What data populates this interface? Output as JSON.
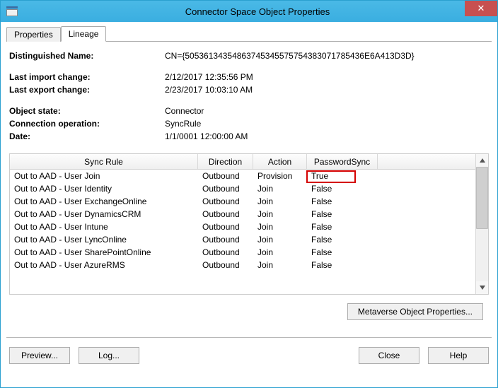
{
  "window": {
    "title": "Connector Space Object Properties"
  },
  "tabs": {
    "properties": "Properties",
    "lineage": "Lineage"
  },
  "info": {
    "dn_label": "Distinguished Name:",
    "dn_value": "CN={50536134354863745345575754383071785436E6A413D3D}",
    "last_import_label": "Last import change:",
    "last_import_value": "2/12/2017 12:35:56 PM",
    "last_export_label": "Last export change:",
    "last_export_value": "2/23/2017 10:03:10 AM",
    "object_state_label": "Object state:",
    "object_state_value": "Connector",
    "conn_op_label": "Connection operation:",
    "conn_op_value": "SyncRule",
    "date_label": "Date:",
    "date_value": "1/1/0001 12:00:00 AM"
  },
  "columns": {
    "rule": "Sync Rule",
    "direction": "Direction",
    "action": "Action",
    "password_sync": "PasswordSync"
  },
  "rows": [
    {
      "rule": "Out to AAD - User Join",
      "direction": "Outbound",
      "action": "Provision",
      "password_sync": "True"
    },
    {
      "rule": "Out to AAD - User Identity",
      "direction": "Outbound",
      "action": "Join",
      "password_sync": "False"
    },
    {
      "rule": "Out to AAD - User ExchangeOnline",
      "direction": "Outbound",
      "action": "Join",
      "password_sync": "False"
    },
    {
      "rule": "Out to AAD - User DynamicsCRM",
      "direction": "Outbound",
      "action": "Join",
      "password_sync": "False"
    },
    {
      "rule": "Out to AAD - User Intune",
      "direction": "Outbound",
      "action": "Join",
      "password_sync": "False"
    },
    {
      "rule": "Out to AAD - User LyncOnline",
      "direction": "Outbound",
      "action": "Join",
      "password_sync": "False"
    },
    {
      "rule": "Out to AAD - User SharePointOnline",
      "direction": "Outbound",
      "action": "Join",
      "password_sync": "False"
    },
    {
      "rule": "Out to AAD - User AzureRMS",
      "direction": "Outbound",
      "action": "Join",
      "password_sync": "False"
    }
  ],
  "buttons": {
    "metaverse": "Metaverse Object Properties...",
    "preview": "Preview...",
    "log": "Log...",
    "close": "Close",
    "help": "Help"
  },
  "highlight": {
    "row_index": 0,
    "column": "password_sync"
  }
}
